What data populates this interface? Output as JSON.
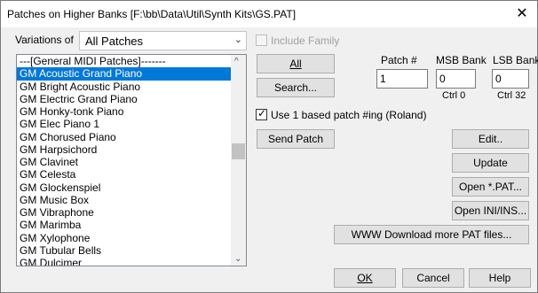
{
  "window": {
    "title": "Patches on Higher Banks [F:\\bb\\Data\\Util\\Synth Kits\\GS.PAT]",
    "close_glyph": "✕"
  },
  "variations": {
    "label": "Variations of",
    "selected": "All Patches"
  },
  "include_family": {
    "label": "Include Family",
    "checked": false,
    "enabled": false
  },
  "patch_list": {
    "items": [
      "---[General MIDI Patches]-------",
      "GM Acoustic Grand Piano",
      "GM Bright Acoustic Piano",
      "GM Electric Grand Piano",
      "GM Honky-tonk Piano",
      "GM Elec Piano 1",
      "GM Chorused Piano",
      "GM Harpsichord",
      "GM Clavinet",
      "GM Celesta",
      "GM Glockenspiel",
      "GM Music Box",
      "GM Vibraphone",
      "GM Marimba",
      "GM Xylophone",
      "GM Tubular Bells",
      "GM Dulcimer"
    ],
    "selected_index": 1
  },
  "fields": {
    "patch_label": "Patch #",
    "patch_value": "1",
    "msb_label": "MSB Bank",
    "msb_value": "0",
    "msb_sub": "Ctrl 0",
    "lsb_label": "LSB Bank",
    "lsb_value": "0",
    "lsb_sub": "Ctrl 32"
  },
  "use_one_based": {
    "label": "Use 1 based patch #ing (Roland)",
    "checked": true
  },
  "buttons": {
    "all": "All",
    "search": "Search...",
    "send_patch": "Send Patch",
    "edit": "Edit..",
    "update": "Update",
    "open_pat": "Open *.PAT...",
    "open_ini": "Open INI/INS...",
    "download": "WWW Download more PAT files...",
    "ok": "OK",
    "cancel": "Cancel",
    "help": "Help"
  },
  "icons": {
    "dropdown": "chevron-down-icon",
    "scroll_up": "scroll-up-arrow-icon",
    "scroll_down": "scroll-down-arrow-icon",
    "close": "close-icon",
    "check": "checkmark-icon"
  }
}
